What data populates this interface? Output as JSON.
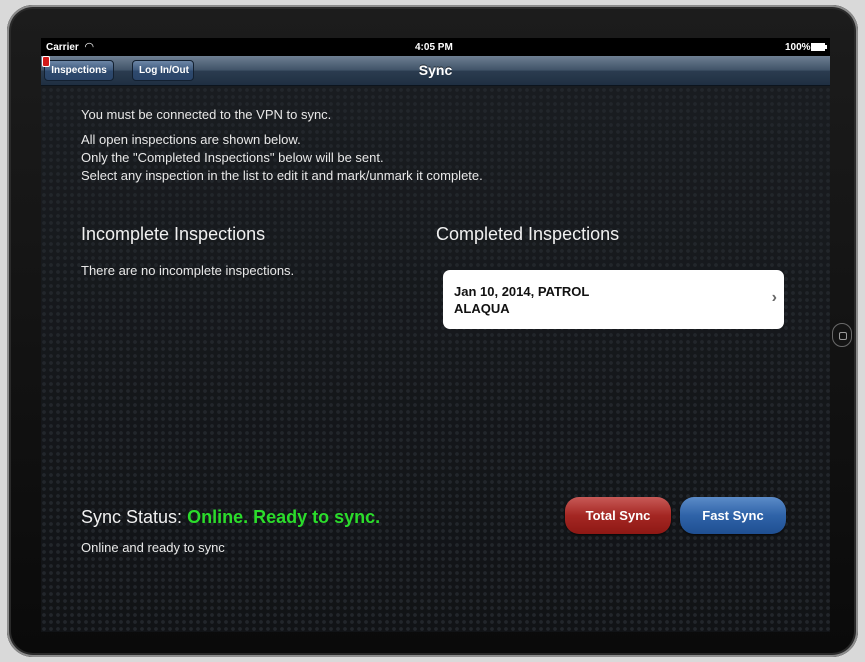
{
  "status_bar": {
    "carrier": "Carrier",
    "wifi_icon": "wifi-icon",
    "time": "4:05 PM",
    "battery": "100%",
    "battery_icon": "battery-icon"
  },
  "nav": {
    "title": "Sync",
    "inspections_button": "Inspections",
    "login_button": "Log In/Out"
  },
  "info": {
    "vpn_notice": "You must be connected to the VPN to sync.",
    "line1": "All open inspections are shown below.",
    "line2": "Only the \"Completed Inspections\" below will be sent.",
    "line3": "Select any inspection in the list to edit it and mark/unmark it complete."
  },
  "incomplete": {
    "heading": "Incomplete Inspections",
    "empty_message": "There are no incomplete inspections."
  },
  "completed": {
    "heading": "Completed Inspections",
    "items": [
      {
        "line1": "Jan 10, 2014, PATROL",
        "line2": "ALAQUA"
      }
    ]
  },
  "sync": {
    "label": "Sync Status:",
    "status": "Online. Ready to sync.",
    "detail": "Online and ready to sync",
    "status_color": "#2bdc2b",
    "total_sync_button": "Total Sync",
    "fast_sync_button": "Fast Sync"
  }
}
